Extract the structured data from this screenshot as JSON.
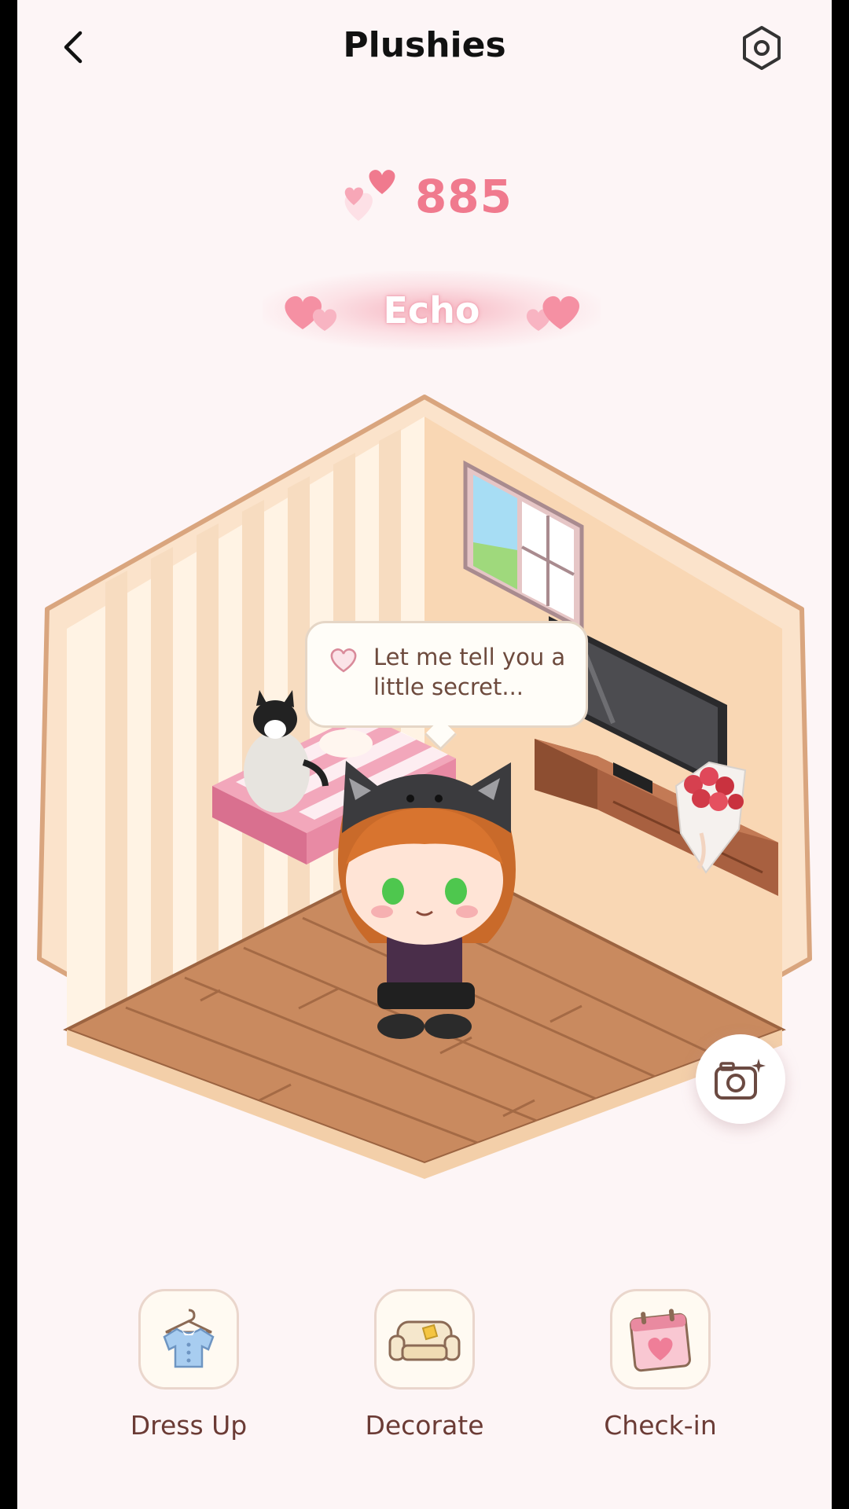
{
  "header": {
    "title": "Plushies",
    "back_icon": "chevron-left-icon",
    "settings_icon": "hexagon-settings-icon"
  },
  "affection": {
    "count": "885",
    "icon": "floating-hearts-icon",
    "color": "#f07a8e"
  },
  "character": {
    "name": "Echo"
  },
  "speech_bubble": {
    "text_line1": "Let me tell you a",
    "text_line2": "little secret...",
    "icon": "heart-icon"
  },
  "camera": {
    "icon": "camera-sparkle-icon"
  },
  "actions": [
    {
      "label": "Dress Up",
      "icon": "shirt-hanger-icon"
    },
    {
      "label": "Decorate",
      "icon": "sofa-icon"
    },
    {
      "label": "Check-in",
      "icon": "calendar-heart-icon"
    }
  ],
  "colors": {
    "background": "#fdf5f6",
    "accent": "#f07a8e",
    "label": "#6b3b35"
  }
}
